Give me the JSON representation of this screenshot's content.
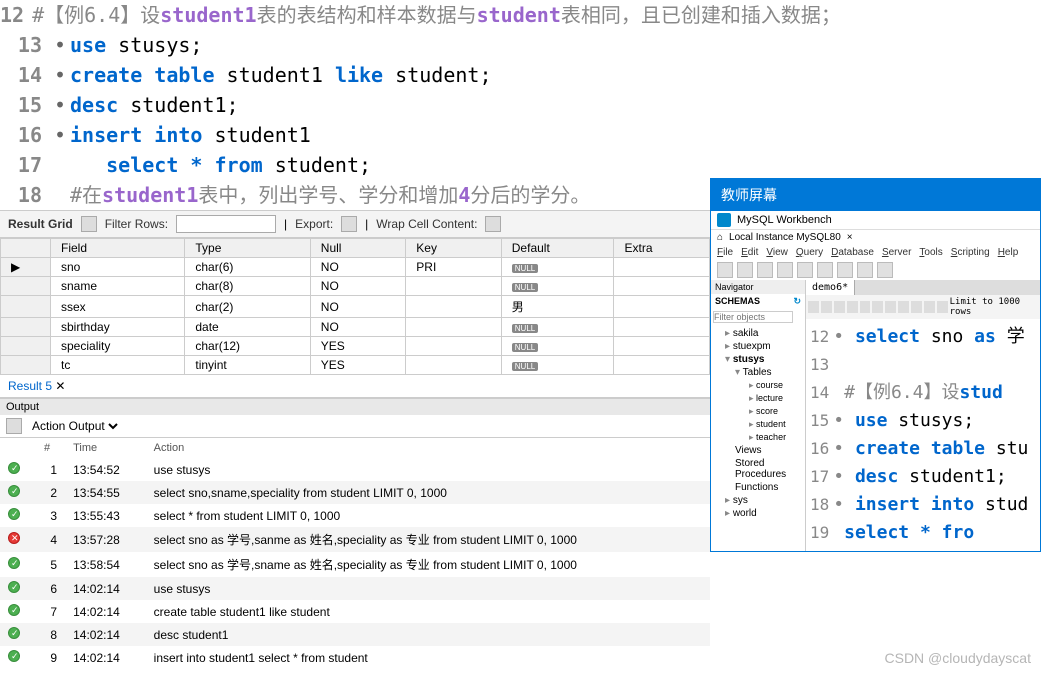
{
  "code_lines": [
    {
      "n": "12",
      "dot": "",
      "html": "<span class='cmt'>#【例6.4】设<span class='kw2'>student1</span>表的表结构和样本数据与<span class='kw2'>student</span>表相同，且已创建和插入数据；</span>"
    },
    {
      "n": "13",
      "dot": "•",
      "html": "<span class='kw'>use</span> stusys;"
    },
    {
      "n": "14",
      "dot": "•",
      "html": "<span class='kw'>create</span> <span class='kw'>table</span> student1 <span class='kw'>like</span> student;"
    },
    {
      "n": "15",
      "dot": "•",
      "html": "<span class='kw'>desc</span> student1;"
    },
    {
      "n": "16",
      "dot": "•",
      "html": "<span class='kw'>insert</span> <span class='kw'>into</span> student1"
    },
    {
      "n": "17",
      "dot": "",
      "html": "   <span class='kw'>select</span> <span class='op'>*</span> <span class='kw'>from</span> student;"
    },
    {
      "n": "18",
      "dot": "",
      "html": "<span class='cmt'>#在<span class='kw2'>student1</span>表中，列出学号、学分和增加<span class='kw2'>4</span>分后的学分。</span>"
    }
  ],
  "toolbar": {
    "result_grid": "Result Grid",
    "filter_rows": "Filter Rows:",
    "export": "Export:",
    "wrap": "Wrap Cell Content:"
  },
  "grid": {
    "headers": [
      "Field",
      "Type",
      "Null",
      "Key",
      "Default",
      "Extra"
    ],
    "rows": [
      [
        "sno",
        "char(6)",
        "NO",
        "PRI",
        "NULL",
        ""
      ],
      [
        "sname",
        "char(8)",
        "NO",
        "",
        "NULL",
        ""
      ],
      [
        "ssex",
        "char(2)",
        "NO",
        "",
        "男",
        ""
      ],
      [
        "sbirthday",
        "date",
        "NO",
        "",
        "NULL",
        ""
      ],
      [
        "speciality",
        "char(12)",
        "YES",
        "",
        "NULL",
        ""
      ],
      [
        "tc",
        "tinyint",
        "YES",
        "",
        "NULL",
        ""
      ]
    ]
  },
  "result_tab": "Result 5",
  "output_header": "Output",
  "output_select": "Action Output",
  "action_headers": [
    "",
    "#",
    "Time",
    "Action"
  ],
  "actions": [
    {
      "s": "ok",
      "n": "1",
      "t": "13:54:52",
      "a": "use stusys"
    },
    {
      "s": "ok",
      "n": "2",
      "t": "13:54:55",
      "a": "select sno,sname,speciality from student LIMIT 0, 1000"
    },
    {
      "s": "ok",
      "n": "3",
      "t": "13:55:43",
      "a": "select * from student LIMIT 0, 1000"
    },
    {
      "s": "err",
      "n": "4",
      "t": "13:57:28",
      "a": "select sno as 学号,sanme as 姓名,speciality as 专业 from student LIMIT 0, 1000"
    },
    {
      "s": "ok",
      "n": "5",
      "t": "13:58:54",
      "a": "select sno as 学号,sname as 姓名,speciality as 专业 from student LIMIT 0, 1000"
    },
    {
      "s": "ok",
      "n": "6",
      "t": "14:02:14",
      "a": "use stusys"
    },
    {
      "s": "ok",
      "n": "7",
      "t": "14:02:14",
      "a": "create table student1 like student"
    },
    {
      "s": "ok",
      "n": "8",
      "t": "14:02:14",
      "a": "desc student1"
    },
    {
      "s": "ok",
      "n": "9",
      "t": "14:02:14",
      "a": "insert into student1 select * from student"
    }
  ],
  "teacher": {
    "title": "教师屏幕",
    "workbench": "MySQL Workbench",
    "conn": "Local Instance MySQL80",
    "menu": [
      "File",
      "Edit",
      "View",
      "Query",
      "Database",
      "Server",
      "Tools",
      "Scripting",
      "Help"
    ],
    "navigator": "Navigator",
    "schemas": "SCHEMAS",
    "filter_ph": "Filter objects",
    "tree": [
      {
        "lvl": "l1",
        "exp": "▸",
        "txt": "sakila"
      },
      {
        "lvl": "l1",
        "exp": "▸",
        "txt": "stuexpm"
      },
      {
        "lvl": "l1",
        "exp": "▾",
        "txt": "stusys",
        "bold": true
      },
      {
        "lvl": "l2",
        "exp": "▾",
        "txt": "Tables"
      },
      {
        "lvl": "l3",
        "exp": "▸",
        "txt": "course"
      },
      {
        "lvl": "l3",
        "exp": "▸",
        "txt": "lecture"
      },
      {
        "lvl": "l3",
        "exp": "▸",
        "txt": "score"
      },
      {
        "lvl": "l3",
        "exp": "▸",
        "txt": "student"
      },
      {
        "lvl": "l3",
        "exp": "▸",
        "txt": "teacher"
      },
      {
        "lvl": "l2",
        "exp": "",
        "txt": "Views"
      },
      {
        "lvl": "l2",
        "exp": "",
        "txt": "Stored Procedures"
      },
      {
        "lvl": "l2",
        "exp": "",
        "txt": "Functions"
      },
      {
        "lvl": "l1",
        "exp": "▸",
        "txt": "sys"
      },
      {
        "lvl": "l1",
        "exp": "▸",
        "txt": "world"
      }
    ],
    "tab": "demo6*",
    "limit": "Limit to 1000 rows",
    "code": [
      {
        "n": "12",
        "d": "•",
        "h": "<span class='kw'>select</span> sno <span class='kw'>as</span> 学"
      },
      {
        "n": "13",
        "d": "",
        "h": ""
      },
      {
        "n": "14",
        "d": "",
        "h": "<span class='cmt'>#【例6.4】设</span><span class='kw'>stud</span>"
      },
      {
        "n": "15",
        "d": "•",
        "h": "<span class='kw'>use</span> stusys;"
      },
      {
        "n": "16",
        "d": "•",
        "h": "<span class='kw'>create</span> <span class='kw'>table</span> stu"
      },
      {
        "n": "17",
        "d": "•",
        "h": "<span class='kw'>desc</span> student1;"
      },
      {
        "n": "18",
        "d": "•",
        "h": "<span class='kw'>insert</span> <span class='kw'>into</span> stud"
      },
      {
        "n": "19",
        "d": "",
        "h": "   <span class='kw'>select</span> <span class='op'>*</span> <span class='kw'>fro</span>"
      }
    ]
  },
  "watermark": "CSDN @cloudydayscat"
}
